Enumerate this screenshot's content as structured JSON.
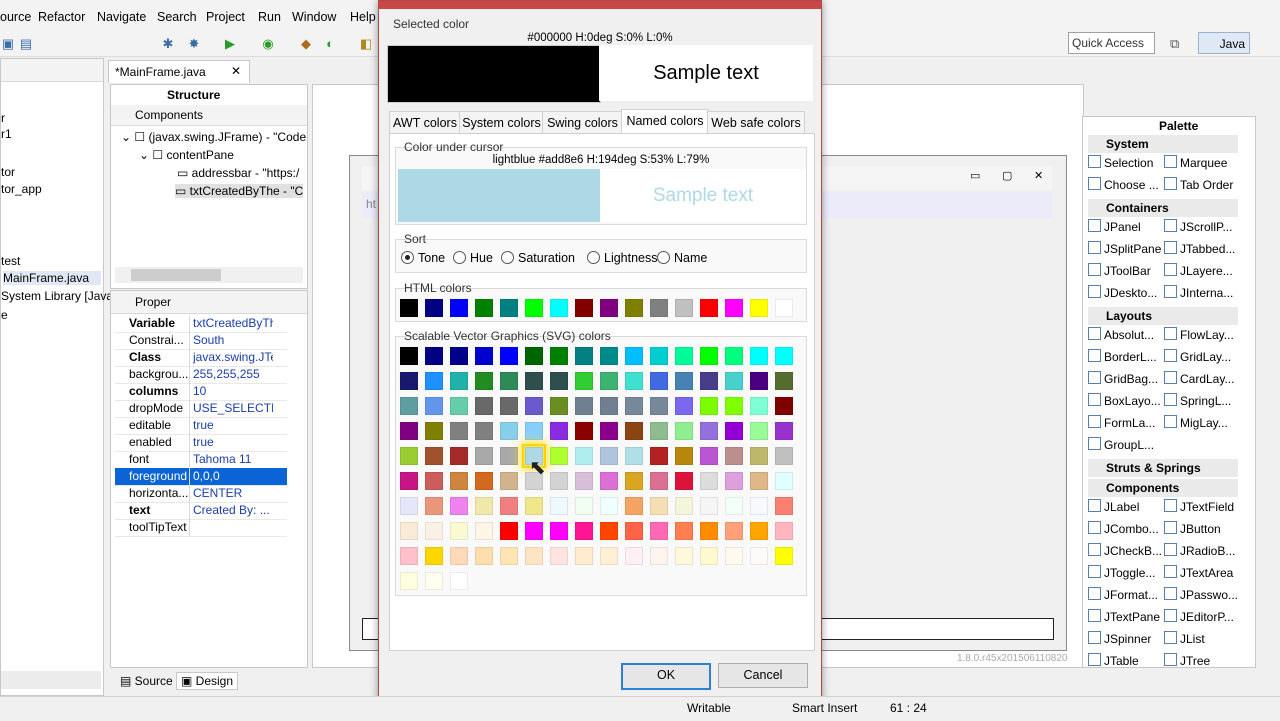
{
  "menu": [
    "ource",
    "Refactor",
    "Navigate",
    "Search",
    "Project",
    "Run",
    "Window",
    "Help"
  ],
  "toolbar": {
    "quick_access": "Quick Access",
    "perspective": "Java"
  },
  "left_view": {
    "items": [
      "r",
      "r1",
      "tor",
      "tor_app",
      "test",
      "MainFrame.java",
      "System Library [Java",
      "e"
    ]
  },
  "editor": {
    "tab_title": "*MainFrame.java",
    "version": "1.8.0.r45x201506110820",
    "content_text": "ht"
  },
  "structure": {
    "title": "Structure",
    "components_label": "Components",
    "tree": [
      "(javax.swing.JFrame) - \"Code",
      "contentPane",
      "addressbar - \"https:/",
      "txtCreatedByThe - \"C"
    ]
  },
  "properties": {
    "title": "Proper",
    "rows": [
      {
        "key": "Variable",
        "value": "txtCreatedByThe",
        "bold": true
      },
      {
        "key": "Constrai...",
        "value": "South",
        "bold": false
      },
      {
        "key": "Class",
        "value": "javax.swing.JTe...",
        "bold": true
      },
      {
        "key": "backgrou...",
        "value": "255,255,255",
        "bold": false
      },
      {
        "key": "columns",
        "value": "10",
        "bold": true
      },
      {
        "key": "dropMode",
        "value": "USE_SELECTION",
        "bold": false
      },
      {
        "key": "editable",
        "value": "true",
        "bold": false
      },
      {
        "key": "enabled",
        "value": "true",
        "bold": false
      },
      {
        "key": "font",
        "value": "Tahoma 11",
        "bold": false
      },
      {
        "key": "foreground",
        "value": "0,0,0",
        "bold": false
      },
      {
        "key": "horizonta...",
        "value": "CENTER",
        "bold": false
      },
      {
        "key": "text",
        "value": "Created By: ...",
        "bold": true
      },
      {
        "key": "toolTipText",
        "value": "",
        "bold": false
      }
    ]
  },
  "bottom_tabs": {
    "source": "Source",
    "design": "Design"
  },
  "palette": {
    "title": "Palette",
    "sections": [
      {
        "name": "System",
        "items": [
          "Selection",
          "Marquee",
          "Choose ...",
          "Tab Order"
        ]
      },
      {
        "name": "Containers",
        "items": [
          "JPanel",
          "JScrollP...",
          "JSplitPane",
          "JTabbed...",
          "JToolBar",
          "JLayere...",
          "JDeskto...",
          "JInterna..."
        ]
      },
      {
        "name": "Layouts",
        "items": [
          "Absolut...",
          "FlowLay...",
          "BorderL...",
          "GridLay...",
          "GridBag...",
          "CardLay...",
          "BoxLayo...",
          "SpringL...",
          "FormLa...",
          "MigLay...",
          "GroupL..."
        ]
      },
      {
        "name": "Struts & Springs",
        "items": []
      },
      {
        "name": "Components",
        "items": [
          "JLabel",
          "JTextField",
          "JCombo...",
          "JButton",
          "JCheckB...",
          "JRadioB...",
          "JToggle...",
          "JTextArea",
          "JFormat...",
          "JPasswo...",
          "JTextPane",
          "JEditorP...",
          "JSpinner",
          "JList",
          "JTable",
          "JTree"
        ]
      }
    ]
  },
  "dialog": {
    "selected_label": "Selected color",
    "selected_info": "#000000 H:0deg S:0% L:0%",
    "selected_color": "#000000",
    "sample_text": "Sample text",
    "tabs": [
      "AWT colors",
      "System colors",
      "Swing colors",
      "Named colors",
      "Web safe colors"
    ],
    "active_tab": "Named colors",
    "cursor_label": "Color under cursor",
    "cursor_info": "lightblue #add8e6 H:194deg S:53% L:79%",
    "cursor_color": "#add8e6",
    "sort_label": "Sort",
    "sort_options": [
      "Tone",
      "Hue",
      "Saturation",
      "Lightness",
      "Name"
    ],
    "sort_selected": "Tone",
    "html_label": "HTML colors",
    "html_colors": [
      "#000000",
      "#000080",
      "#0000ff",
      "#008000",
      "#008080",
      "#00ff00",
      "#00ffff",
      "#800000",
      "#800080",
      "#808000",
      "#808080",
      "#c0c0c0",
      "#ff0000",
      "#ff00ff",
      "#ffff00",
      "#ffffff"
    ],
    "svg_label": "Scalable Vector Graphics (SVG) colors",
    "svg_colors": [
      "#000000",
      "#000080",
      "#00008b",
      "#0000cd",
      "#0000ff",
      "#006400",
      "#008000",
      "#008080",
      "#008b8b",
      "#00bfff",
      "#00ced1",
      "#00fa9a",
      "#00ff00",
      "#00ff7f",
      "#00ffff",
      "#00ffff",
      "#191970",
      "#1e90ff",
      "#20b2aa",
      "#228b22",
      "#2e8b57",
      "#2f4f4f",
      "#2f4f4f",
      "#32cd32",
      "#3cb371",
      "#40e0d0",
      "#4169e1",
      "#4682b4",
      "#483d8b",
      "#48d1cc",
      "#4b0082",
      "#556b2f",
      "#5f9ea0",
      "#6495ed",
      "#66cdaa",
      "#696969",
      "#696969",
      "#6a5acd",
      "#6b8e23",
      "#708090",
      "#708090",
      "#778899",
      "#778899",
      "#7b68ee",
      "#7cfc00",
      "#7fff00",
      "#7fffd4",
      "#800000",
      "#800080",
      "#808000",
      "#808080",
      "#808080",
      "#87ceeb",
      "#87cefa",
      "#8a2be2",
      "#8b0000",
      "#8b008b",
      "#8b4513",
      "#8fbc8f",
      "#90ee90",
      "#9370db",
      "#9400d3",
      "#98fb98",
      "#9932cc",
      "#9acd32",
      "#a0522d",
      "#a52a2a",
      "#a9a9a9",
      "#a9a9a9",
      "#add8e6",
      "#adff2f",
      "#afeeee",
      "#b0c4de",
      "#b0e0e6",
      "#b22222",
      "#b8860b",
      "#ba55d3",
      "#bc8f8f",
      "#bdb76b",
      "#c0c0c0",
      "#c71585",
      "#cd5c5c",
      "#cd853f",
      "#d2691e",
      "#d2b48c",
      "#d3d3d3",
      "#d3d3d3",
      "#d8bfd8",
      "#da70d6",
      "#daa520",
      "#db7093",
      "#dc143c",
      "#dcdcdc",
      "#dda0dd",
      "#deb887",
      "#e0ffff",
      "#e6e6fa",
      "#e9967a",
      "#ee82ee",
      "#eee8aa",
      "#f08080",
      "#f0e68c",
      "#f0f8ff",
      "#f0fff0",
      "#f0ffff",
      "#f4a460",
      "#f5deb3",
      "#f5f5dc",
      "#f5f5f5",
      "#f5fffa",
      "#f8f8ff",
      "#fa8072",
      "#faebd7",
      "#faf0e6",
      "#fafad2",
      "#fdf5e6",
      "#ff0000",
      "#ff00ff",
      "#ff00ff",
      "#ff1493",
      "#ff4500",
      "#ff6347",
      "#ff69b4",
      "#ff7f50",
      "#ff8c00",
      "#ffa07a",
      "#ffa500",
      "#ffb6c1",
      "#ffc0cb",
      "#ffd700",
      "#ffdab9",
      "#ffdead",
      "#ffe4b5",
      "#ffe4c4",
      "#ffe4e1",
      "#ffebcd",
      "#ffefd5",
      "#fff0f5",
      "#fff5ee",
      "#fff8dc",
      "#fffacd",
      "#fffaf0",
      "#fffafa",
      "#ffff00",
      "#ffffe0",
      "#fffff0",
      "#ffffff"
    ],
    "ok_label": "OK",
    "cancel_label": "Cancel"
  },
  "statusbar": {
    "writable": "Writable",
    "insert_mode": "Smart Insert",
    "position": "61 : 24"
  }
}
